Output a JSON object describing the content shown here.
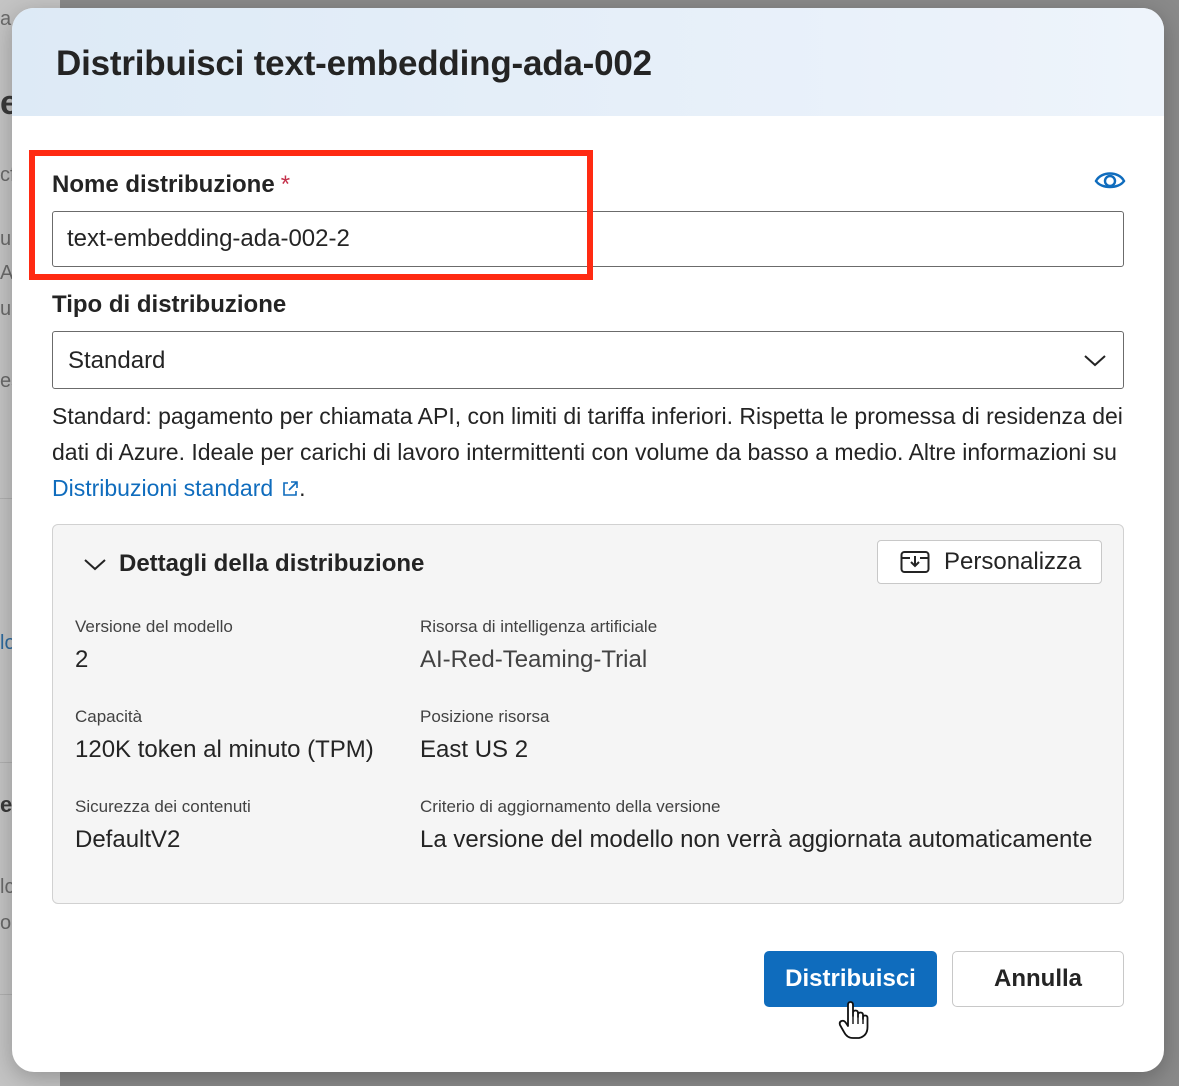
{
  "background": {
    "fragments": [
      "a",
      "el",
      "cf",
      "ur",
      "A",
      "u",
      "es",
      "lo",
      "er",
      "lc",
      "or"
    ]
  },
  "dialog": {
    "title": "Distribuisci text-embedding-ada-002",
    "deployment_name": {
      "label": "Nome distribuzione",
      "required_marker": "*",
      "value": "text-embedding-ada-002-2"
    },
    "deployment_type": {
      "label": "Tipo di distribuzione",
      "selected": "Standard"
    },
    "description": {
      "text": "Standard: pagamento per chiamata API, con limiti di tariffa inferiori. Rispetta le promessa di residenza dei dati di Azure. Ideale per carichi di lavoro intermittenti con volume da basso a medio. Altre informazioni su ",
      "link_text": "Distribuzioni standard",
      "suffix": "."
    },
    "details": {
      "title": "Dettagli della distribuzione",
      "customize_label": "Personalizza",
      "fields": {
        "model_version": {
          "label": "Versione del modello",
          "value": "2"
        },
        "ai_resource": {
          "label": "Risorsa di intelligenza artificiale",
          "value": "AI-Red-Teaming-Trial"
        },
        "capacity": {
          "label": "Capacità",
          "value": "120K token al minuto (TPM)"
        },
        "resource_location": {
          "label": "Posizione risorsa",
          "value": "East US 2"
        },
        "content_safety": {
          "label": "Sicurezza dei contenuti",
          "value": "DefaultV2"
        },
        "version_update_policy": {
          "label": "Criterio di aggiornamento della versione",
          "value": "La versione del modello non verrà aggiornata automaticamente"
        }
      }
    },
    "buttons": {
      "deploy": "Distribuisci",
      "cancel": "Annulla"
    }
  },
  "colors": {
    "primary": "#0f6cbd",
    "highlight": "#ff2a12",
    "required": "#c4314b"
  },
  "icons": [
    "eye-icon",
    "chevron-down-icon",
    "external-link-icon",
    "collapse-chevron-icon",
    "customize-icon",
    "hand-cursor-icon"
  ]
}
